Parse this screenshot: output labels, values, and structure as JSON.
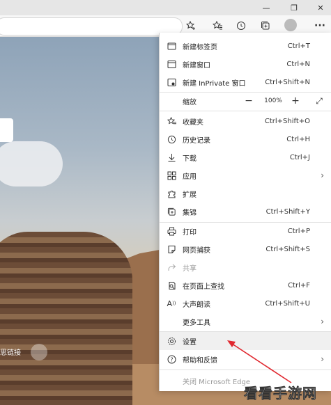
{
  "window": {
    "minimize": "—",
    "restore": "❐",
    "close": "✕"
  },
  "toolbar": {
    "favorite_icon": "star-add-icon",
    "favorites_icon": "favorites-icon",
    "history_icon": "history-icon",
    "collections_icon": "collections-icon",
    "profile_icon": "avatar",
    "more": "···"
  },
  "menu": {
    "new_tab": {
      "label": "新建标签页",
      "shortcut": "Ctrl+T"
    },
    "new_window": {
      "label": "新建窗口",
      "shortcut": "Ctrl+N"
    },
    "new_inprivate": {
      "label": "新建 InPrivate 窗口",
      "shortcut": "Ctrl+Shift+N"
    },
    "zoom": {
      "label": "缩放",
      "value": "100%"
    },
    "favorites": {
      "label": "收藏夹",
      "shortcut": "Ctrl+Shift+O"
    },
    "history": {
      "label": "历史记录",
      "shortcut": "Ctrl+H"
    },
    "downloads": {
      "label": "下载",
      "shortcut": "Ctrl+J"
    },
    "apps": {
      "label": "应用"
    },
    "extensions": {
      "label": "扩展"
    },
    "collections": {
      "label": "集锦",
      "shortcut": "Ctrl+Shift+Y"
    },
    "print": {
      "label": "打印",
      "shortcut": "Ctrl+P"
    },
    "web_capture": {
      "label": "网页捕获",
      "shortcut": "Ctrl+Shift+S"
    },
    "share": {
      "label": "共享"
    },
    "find": {
      "label": "在页面上查找",
      "shortcut": "Ctrl+F"
    },
    "read_aloud": {
      "label": "大声朗读",
      "shortcut": "Ctrl+Shift+U"
    },
    "more_tools": {
      "label": "更多工具"
    },
    "settings": {
      "label": "设置"
    },
    "help": {
      "label": "帮助和反馈"
    },
    "close_edge": {
      "label": "关闭 Microsoft Edge"
    }
  },
  "background": {
    "link_text": "思链接"
  },
  "watermark": "看看手游网",
  "colors": {
    "arrow": "#e0282f",
    "menu_hover": "#f0f0f0"
  }
}
